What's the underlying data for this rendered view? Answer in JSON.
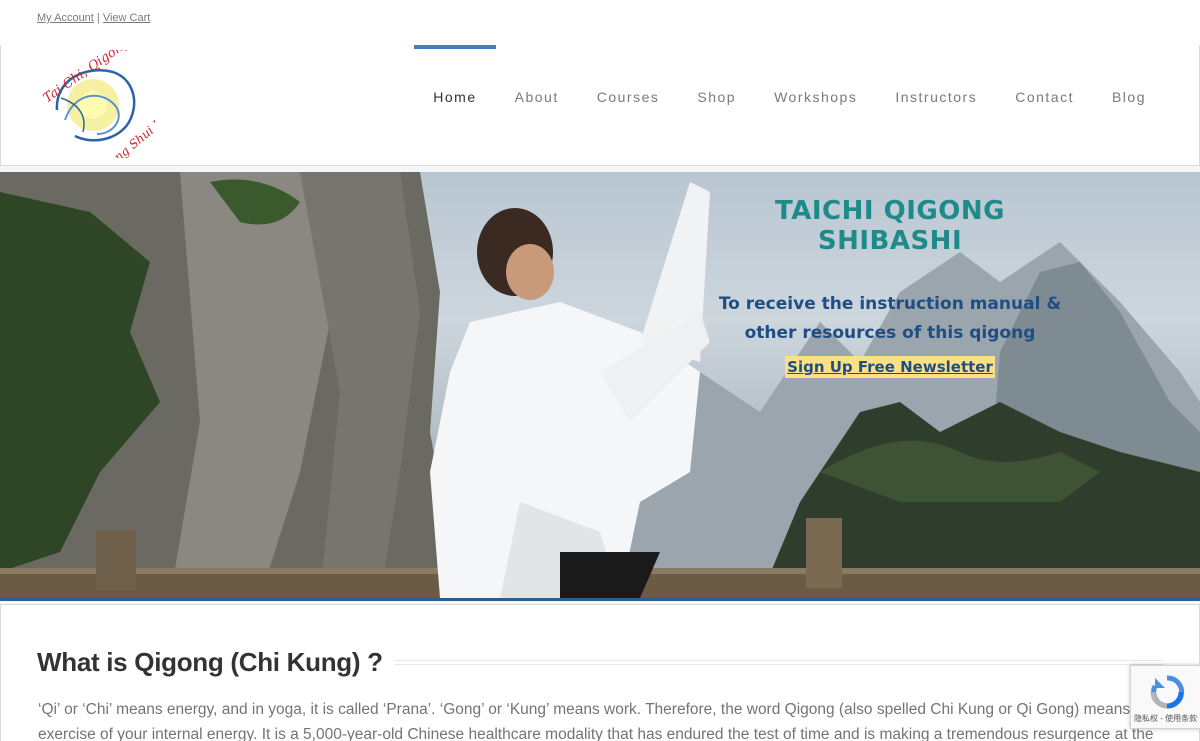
{
  "topbar": {
    "my_account": "My Account",
    "separator": "|",
    "view_cart": "View Cart"
  },
  "logo": {
    "text_top": "Tai Chi, Qigong &",
    "text_bottom": "Feng Shui Institute"
  },
  "nav": {
    "items": [
      {
        "label": "Home",
        "active": true
      },
      {
        "label": "About"
      },
      {
        "label": "Courses"
      },
      {
        "label": "Shop"
      },
      {
        "label": "Workshops"
      },
      {
        "label": "Instructors"
      },
      {
        "label": "Contact"
      },
      {
        "label": "Blog"
      }
    ]
  },
  "hero": {
    "title": "TAICHI QIGONG SHIBASHI",
    "subtitle_line1": "To receive the instruction manual &",
    "subtitle_line2": "other resources of this qigong",
    "cta": "Sign Up Free Newsletter"
  },
  "content": {
    "heading": "What is Qigong (Chi Kung) ?",
    "paragraph_line1": "‘Qi’ or ‘Chi’ means energy, and in yoga, it is called ‘Prana’. ‘Gong’ or ‘Kung’ means work. Therefore, the word Qigong (also spelled Chi Kung or Qi Gong) means the",
    "paragraph_line2": "exercise of your internal energy. It is a 5,000-year-old Chinese healthcare modality that has endured the test of time and is making a tremendous resurgence at the"
  },
  "recaptcha": {
    "text": "隐私权 - 使用条款"
  },
  "colors": {
    "nav_active": "#3f80c0",
    "hero_title": "#1e8a8a",
    "hero_sub": "#1f4e85",
    "cta_bg": "#fbe086"
  }
}
